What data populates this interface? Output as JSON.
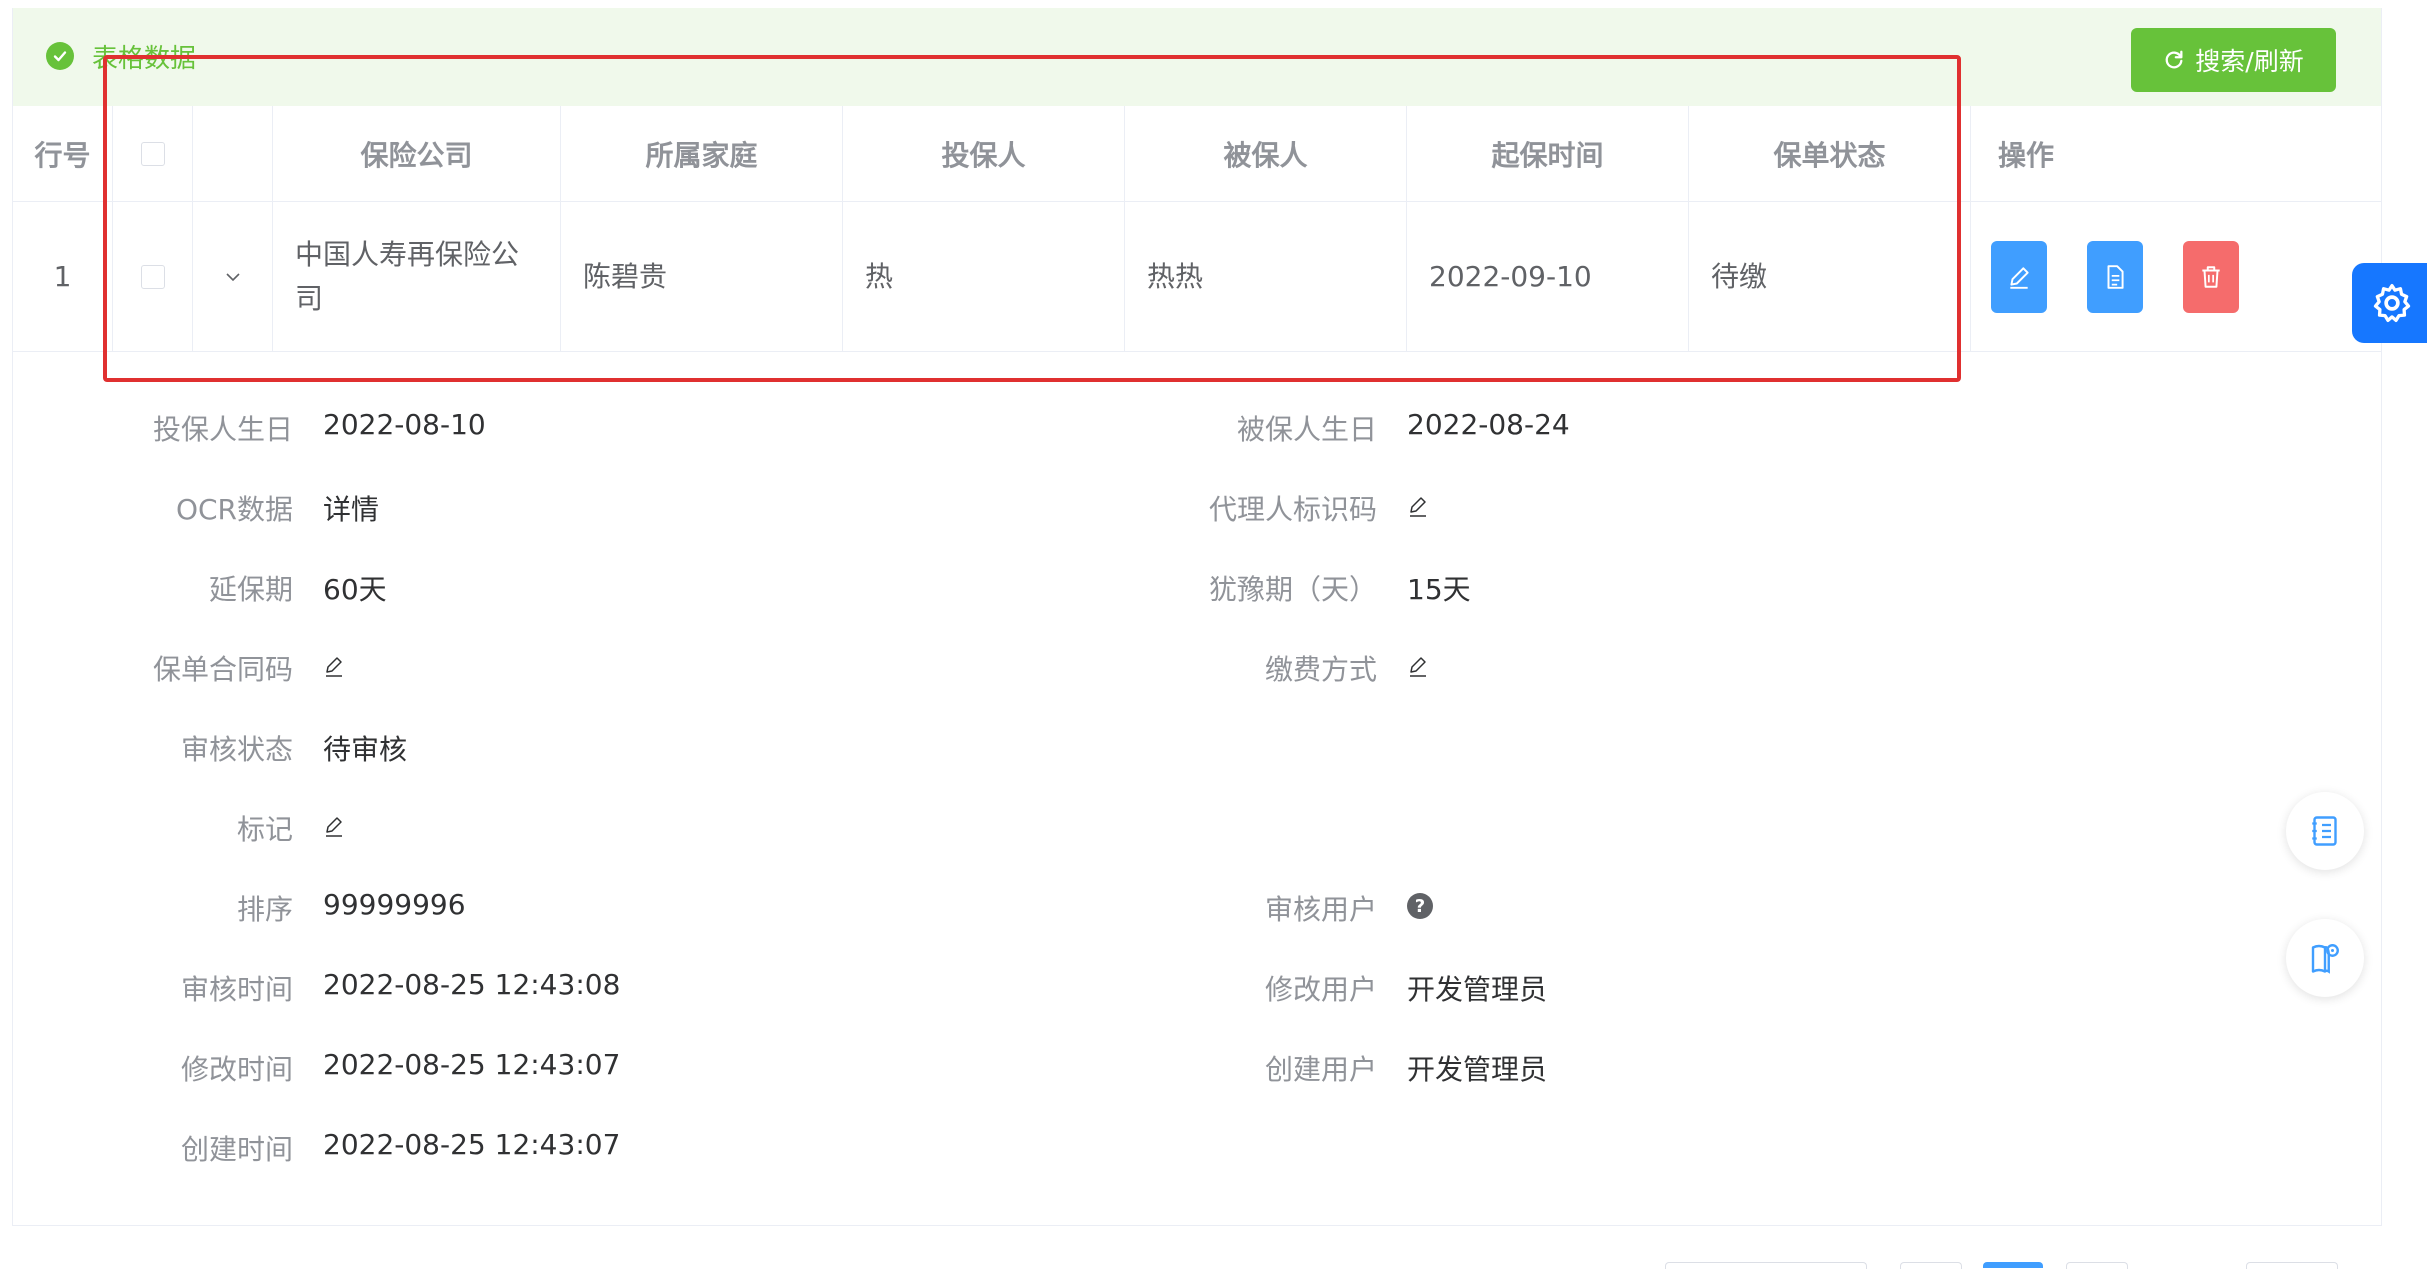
{
  "header": {
    "title": "表格数据",
    "refresh_label": "搜索/刷新"
  },
  "table": {
    "columns": [
      "行号",
      "",
      "",
      "保险公司",
      "所属家庭",
      "投保人",
      "被保人",
      "起保时间",
      "保单状态",
      "操作"
    ],
    "rows": [
      {
        "row_no": "1",
        "company": "中国人寿再保险公司",
        "family": "陈碧贵",
        "policyholder": "热",
        "insured": "热热",
        "start_date": "2022-09-10",
        "status": "待缴"
      }
    ]
  },
  "details": {
    "left": [
      {
        "label": "投保人生日",
        "value": "2022-08-10",
        "icon": ""
      },
      {
        "label": "OCR数据",
        "value": "详情",
        "icon": ""
      },
      {
        "label": "延保期",
        "value": "60天",
        "icon": ""
      },
      {
        "label": "保单合同码",
        "value": "",
        "icon": "edit-icon"
      },
      {
        "label": "审核状态",
        "value": "待审核",
        "icon": ""
      },
      {
        "label": "标记",
        "value": "",
        "icon": "edit-icon"
      },
      {
        "label": "排序",
        "value": "99999996",
        "icon": ""
      },
      {
        "label": "审核时间",
        "value": "2022-08-25 12:43:08",
        "icon": ""
      },
      {
        "label": "修改时间",
        "value": "2022-08-25 12:43:07",
        "icon": ""
      },
      {
        "label": "创建时间",
        "value": "2022-08-25 12:43:07",
        "icon": ""
      }
    ],
    "right": [
      {
        "label": "被保人生日",
        "value": "2022-08-24",
        "icon": ""
      },
      {
        "label": "代理人标识码",
        "value": "",
        "icon": "edit-icon"
      },
      {
        "label": "犹豫期（天）",
        "value": "15天",
        "icon": ""
      },
      {
        "label": "缴费方式",
        "value": "",
        "icon": "edit-icon"
      },
      {
        "label": "审核用户",
        "value": "",
        "icon": "help-icon"
      },
      {
        "label": "修改用户",
        "value": "开发管理员",
        "icon": ""
      },
      {
        "label": "创建用户",
        "value": "开发管理员",
        "icon": ""
      }
    ]
  },
  "colors": {
    "success": "#67c23a",
    "primary": "#409eff",
    "danger": "#f56c6c",
    "highlight": "#e03030"
  }
}
